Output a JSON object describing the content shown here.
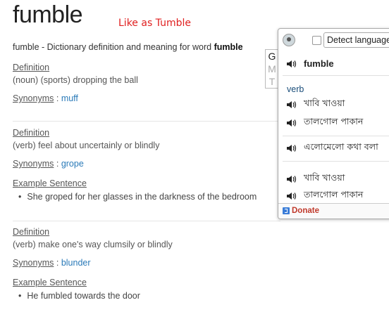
{
  "page": {
    "word": "fumble",
    "annotation": "Like as Tumble",
    "subtitle_prefix": "fumble - Dictionary definition and meaning for word ",
    "subtitle_word": "fumble"
  },
  "entries": [
    {
      "definition_label": "Definition",
      "definition": "(noun) (sports) dropping the ball",
      "synonyms_label": "Synonyms",
      "synonym": "muff"
    },
    {
      "definition_label": "Definition",
      "definition": "(verb) feel about uncertainly or blindly",
      "synonyms_label": "Synonyms",
      "synonym": "grope",
      "example_label": "Example Sentence",
      "example": "She groped for her glasses in the darkness of the bedroom"
    },
    {
      "definition_label": "Definition",
      "definition": "(verb) make one's way clumsily or blindly",
      "synonyms_label": "Synonyms",
      "synonym": "blunder",
      "example_label": "Example Sentence",
      "example": "He fumbled towards the door"
    }
  ],
  "sep": ":",
  "gmt_tab": [
    "G",
    "M",
    "T"
  ],
  "translator": {
    "detect_language": "Detect language",
    "headword": "fumble",
    "pos": "verb",
    "translations": [
      "খাবি খাওয়া",
      "তালগোল পাকান",
      "এলোমেলো কথা বলা",
      "খাবি খাওয়া",
      "তালগোল পাকান"
    ],
    "donate": "Donate"
  },
  "colors": {
    "link": "#2a7ab8",
    "annotation": "#e02020",
    "donate": "#c0392b"
  }
}
